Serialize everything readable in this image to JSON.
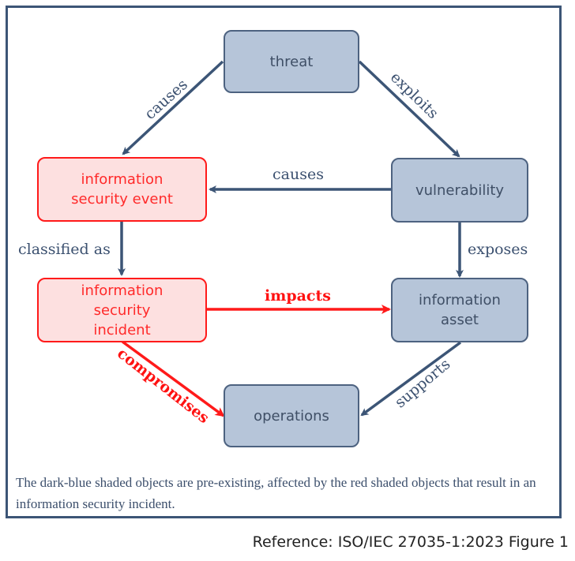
{
  "colors": {
    "pre_existing_fill": "#b6c5d9",
    "pre_existing_border": "#4d6280",
    "incident_fill": "#fde0e0",
    "incident_border": "#ff1a1a",
    "arrow_blue": "#3c5576",
    "arrow_red": "#ff1a1a"
  },
  "nodes": {
    "threat": "threat",
    "vulnerability": "vulnerability",
    "event": "information security event",
    "incident": "information security incident",
    "asset": "information asset",
    "operations": "operations"
  },
  "relations": {
    "threat_causes_event": "causes",
    "threat_exploits_vulnerability": "exploits",
    "vulnerability_causes_event": "causes",
    "event_classified_as_incident": "classified as",
    "vulnerability_exposes_asset": "exposes",
    "incident_impacts_asset": "impacts",
    "incident_compromises_operations": "compromises",
    "asset_supports_operations": "supports"
  },
  "note": "The dark-blue shaded objects are pre-existing, affected by the red shaded objects that result in an information security incident.",
  "reference": "Reference: ISO/IEC 27035-1:2023 Figure 1"
}
